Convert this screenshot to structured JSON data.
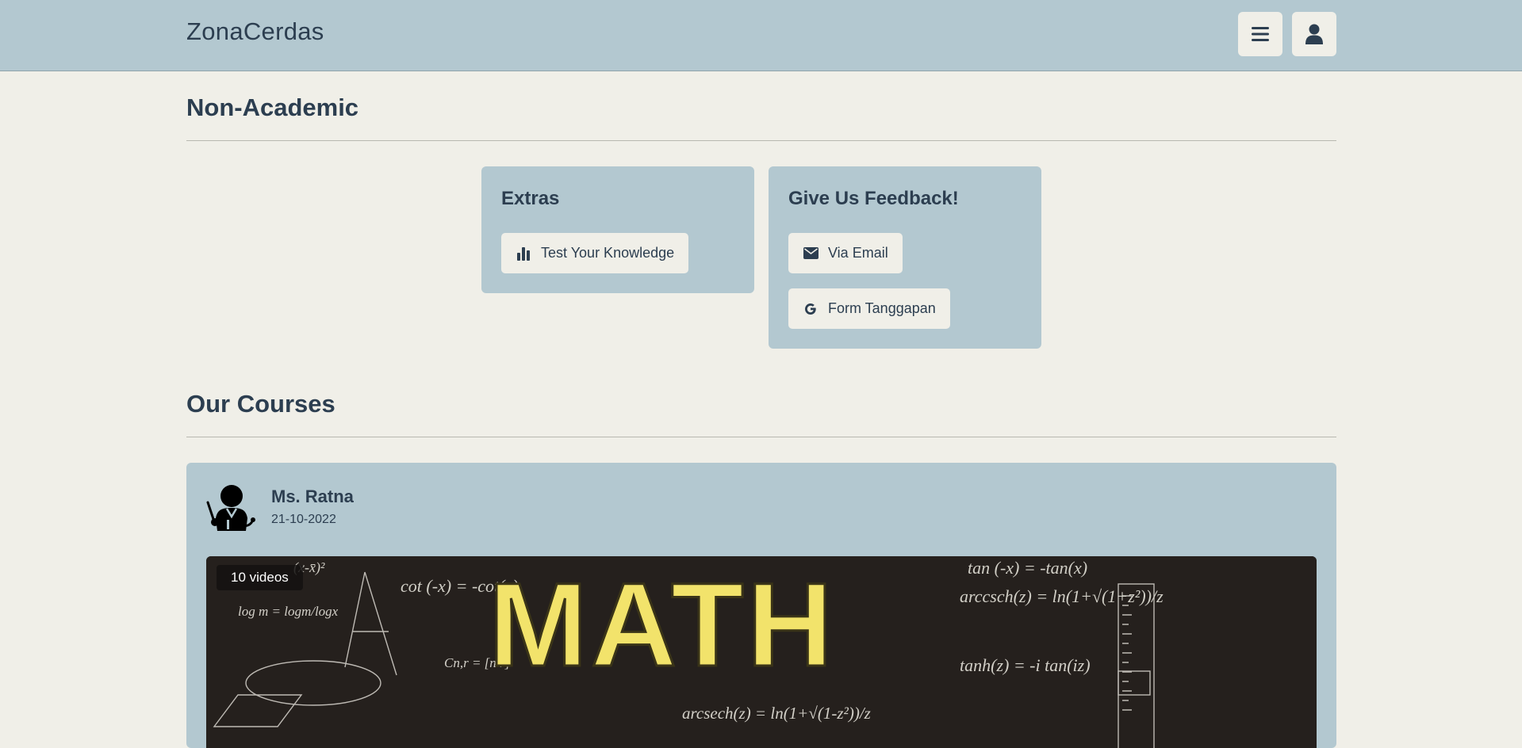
{
  "navbar": {
    "brand": "ZonaCerdas",
    "menu_icon": "hamburger-icon",
    "user_icon": "user-icon"
  },
  "non_academic": {
    "title": "Non-Academic",
    "extras": {
      "title": "Extras",
      "buttons": [
        {
          "label": "Test Your Knowledge",
          "icon": "bar-chart-icon"
        }
      ]
    },
    "feedback": {
      "title": "Give Us Feedback!",
      "buttons": [
        {
          "label": "Via Email",
          "icon": "envelope-icon"
        },
        {
          "label": "Form Tanggapan",
          "icon": "google-icon"
        }
      ]
    }
  },
  "courses": {
    "title": "Our Courses",
    "items": [
      {
        "teacher": "Ms. Ratna",
        "date": "21-10-2022",
        "video_count": "10 videos",
        "thumbnail_word": "MATH",
        "formulas": [
          "cot (-x) = -cot(x)",
          "tan (-x) = -tan(x)",
          "arccsch(z) = ln(1+√(1+z²))/z",
          "log m = logm/logx",
          "tanh(z) = -i tan(iz)",
          "arcsech(z) = ln(1+√(1-z²))/z",
          "(x-x̄)²",
          "Cn,r = [n r]"
        ]
      }
    ]
  },
  "colors": {
    "background": "#f0efe8",
    "navbar": "#b3c8d0",
    "card": "#b3c8d0",
    "text": "#2c3e50",
    "math_word": "#f2e36b"
  }
}
